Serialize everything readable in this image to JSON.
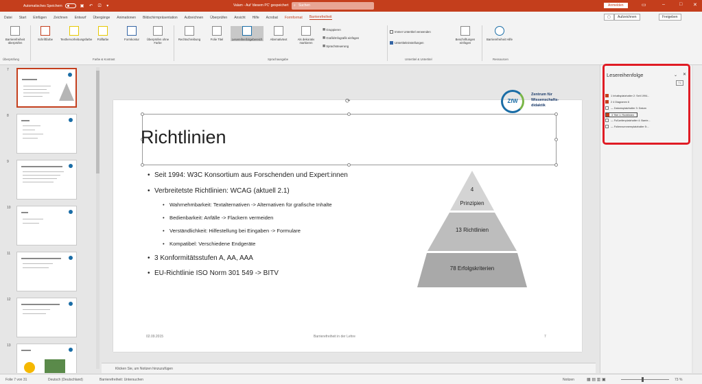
{
  "titlebar": {
    "autosave": "Automatisches Speichern",
    "document": "Valam - Auf 'diesem PC' gespeichert",
    "search": "Suchen",
    "signin": "Anmelden"
  },
  "menu": {
    "tabs": [
      "Datei",
      "Start",
      "Einfügen",
      "Zeichnen",
      "Entwurf",
      "Übergänge",
      "Animationen",
      "Bildschirmpräsentation",
      "Aufzeichnen",
      "Überprüfen",
      "Ansicht",
      "Hilfe",
      "Acrobat",
      "Formformat",
      "Barrierefreiheit"
    ],
    "record_btn": "Aufzeichnen",
    "share_btn": "Freigeben"
  },
  "ribbon": {
    "buttons": [
      "Barrierefreiheit überprüfen",
      "Schriftfarbe",
      "Texthervorhebungsfarbe",
      "Füllfarbe",
      "Formkontur",
      "Überprüfen ohne Farbe",
      "Rechtschreibung",
      "Folie Titel",
      "Lesereihenfolgebereich",
      "Alternativtext",
      "Als dekorativ markieren"
    ],
    "small_items": [
      "Gruppieren",
      "Grafik/Infografik einfügen",
      "Sprachsteuerung"
    ],
    "checks": [
      "Immer Untertitel verwenden",
      "Untertiteleinstellungen"
    ],
    "extra_buttons": [
      "Beschriftungen einfügen",
      "Barrierefreiheit Hilfe"
    ],
    "groups": [
      "Überprüfung",
      "Farbe & Kontrast",
      "Sprachausgabe",
      "Untertitel & Untertitel",
      "Ressourcen"
    ]
  },
  "thumbnails": {
    "numbers": [
      "7",
      "8",
      "9",
      "10",
      "11",
      "12",
      "13"
    ]
  },
  "slide": {
    "title": "Richtlinien",
    "bullets": [
      "Seit 1994: W3C Konsortium aus Forschenden und Expert:innen",
      "Verbreitetste Richtlinien: WCAG (aktuell 2.1)"
    ],
    "subbullets": [
      "Wahrnehmbarkeit: Textalternativen -> Alternativen für grafische Inhalte",
      "Bedienbarkeit: Anfälle -> Flackern vermeiden",
      "Verständlichkeit: Hilfestellung bei Eingaben -> Formulare",
      "Kompatibel: Verschiedene Endgeräte"
    ],
    "bullet3": "3 Konformitätsstufen A, AA, AAA",
    "bullet4": "EU-Richtlinie ISO Norm 301 549 -> BITV",
    "pyramid": {
      "top_num": "4",
      "top_label": "Prinzipien",
      "middle": "13 Richtlinien",
      "bottom": "78 Erfolgskriterien"
    },
    "logo": {
      "abbr": "ZfW",
      "line1": "Zentrum für",
      "line2": "Wissenschafts-",
      "line3": "didaktik"
    },
    "footer_date": "02.09.2015",
    "footer_center": "Barrierefreiheit in der Lehre",
    "footer_page": "7"
  },
  "notes": "Klicken Sie, um Notizen hinzuzufügen",
  "status": {
    "left": "Folie 7 von 31",
    "lang": "Deutsch (Deutschland)",
    "access": "Barrierefreiheit: Untersuchen",
    "notes": "Notizen",
    "zoom": "73 %"
  },
  "reading_order": {
    "title": "Lesereihenfolge",
    "items": [
      "1 Inhaltsplatzhalter 2: Seit 1994...",
      "2 4 Diagramm 6",
      "— Datumsplatzhalter 3: Datum",
      "3 Titel 1: Richtlinien",
      "— Fußzeilenplatzhalter 4: Barrie...",
      "— Foliennummernplatzhalter 5:..."
    ],
    "checked": [
      true,
      true,
      false,
      true,
      false,
      false
    ]
  }
}
